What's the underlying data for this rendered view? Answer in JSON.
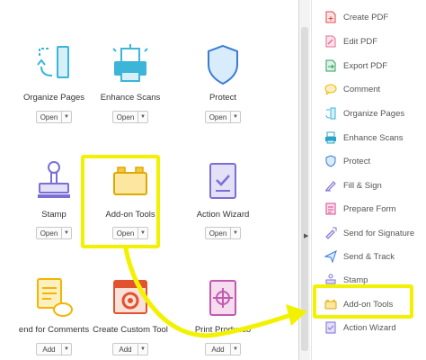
{
  "tools": [
    {
      "name": "Organize Pages",
      "button": "Open",
      "icon": "organize-pages-icon"
    },
    {
      "name": "Enhance Scans",
      "button": "Open",
      "icon": "enhance-scans-icon"
    },
    {
      "name": "Protect",
      "button": "Open",
      "icon": "protect-icon"
    },
    {
      "name": "Stamp",
      "button": "Open",
      "icon": "stamp-icon"
    },
    {
      "name": "Add-on Tools",
      "button": "Open",
      "icon": "add-on-tools-icon"
    },
    {
      "name": "Action Wizard",
      "button": "Open",
      "icon": "action-wizard-icon"
    },
    {
      "name": "end for Comments",
      "button": "Add",
      "icon": "send-for-comments-icon"
    },
    {
      "name": "Create Custom Tool",
      "button": "Add",
      "icon": "create-custom-tool-icon"
    },
    {
      "name": "Print Productio",
      "button": "Add",
      "icon": "print-production-icon"
    }
  ],
  "panel": {
    "items": [
      {
        "label": "Create PDF",
        "icon": "create-pdf-icon",
        "color": "#e0474c"
      },
      {
        "label": "Edit PDF",
        "icon": "edit-pdf-icon",
        "color": "#e86b8c"
      },
      {
        "label": "Export PDF",
        "icon": "export-pdf-icon",
        "color": "#2e9e5e"
      },
      {
        "label": "Comment",
        "icon": "comment-icon",
        "color": "#f4b400"
      },
      {
        "label": "Organize Pages",
        "icon": "organize-pages-icon",
        "color": "#3bb5d8"
      },
      {
        "label": "Enhance Scans",
        "icon": "enhance-scans-icon",
        "color": "#2aa5c9"
      },
      {
        "label": "Protect",
        "icon": "protect-icon",
        "color": "#3a7bd5"
      },
      {
        "label": "Fill & Sign",
        "icon": "fill-sign-icon",
        "color": "#7b6fd6"
      },
      {
        "label": "Prepare Form",
        "icon": "prepare-form-icon",
        "color": "#d9448a"
      },
      {
        "label": "Send for Signature",
        "icon": "send-for-signature-icon",
        "color": "#7b6fd6"
      },
      {
        "label": "Send & Track",
        "icon": "send-track-icon",
        "color": "#3a7bd5"
      },
      {
        "label": "Stamp",
        "icon": "stamp-icon",
        "color": "#7b6fd6"
      },
      {
        "label": "Add-on Tools",
        "icon": "add-on-tools-icon",
        "color": "#f4b400"
      },
      {
        "label": "Action Wizard",
        "icon": "action-wizard-icon",
        "color": "#7b6fd6"
      }
    ]
  },
  "colors": {
    "highlight": "#f2f200",
    "accent_blue": "#3bb5d8"
  }
}
